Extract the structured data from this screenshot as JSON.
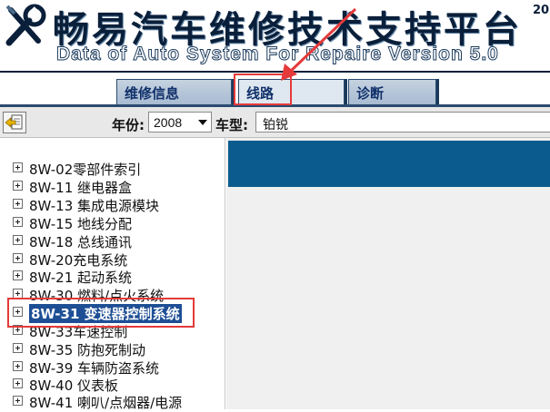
{
  "banner": {
    "title": "畅易汽车维修技术支持平台",
    "title_overflow": "20",
    "subtitle": "Data of Auto System For Repaire Version 5.0"
  },
  "tabs": [
    {
      "label": "维修信息",
      "active": false
    },
    {
      "label": "线路",
      "active": true
    },
    {
      "label": "诊断",
      "active": false
    }
  ],
  "filter": {
    "year_label": "年份:",
    "year_value": "2008",
    "model_label": "车型:",
    "model_value": "铂锐"
  },
  "tree": {
    "items": [
      {
        "label": "8W-02零部件索引"
      },
      {
        "label": "8W-11 继电器盒"
      },
      {
        "label": "8W-13 集成电源模块"
      },
      {
        "label": "8W-15 地线分配"
      },
      {
        "label": "8W-18 总线通讯"
      },
      {
        "label": "8W-20充电系统"
      },
      {
        "label": "8W-21 起动系统"
      },
      {
        "label": "8W-30 燃料/点火系统"
      },
      {
        "label": "8W-31 变速器控制系统",
        "selected": true
      },
      {
        "label": "8W-33车速控制"
      },
      {
        "label": "8W-35 防抱死制动"
      },
      {
        "label": "8W-39 车辆防盗系统"
      },
      {
        "label": "8W-40 仪表板"
      },
      {
        "label": "8W-41 喇叭/点烟器/电源"
      }
    ]
  },
  "colors": {
    "highlight_box": "#e53a3a",
    "selection": "#1e4f95",
    "right_header": "#0b5b8e"
  },
  "icons": {
    "logo": "wrench-screwdriver-icon",
    "back": "back-arrow-icon",
    "tree_node": "plus-expand-icon"
  }
}
